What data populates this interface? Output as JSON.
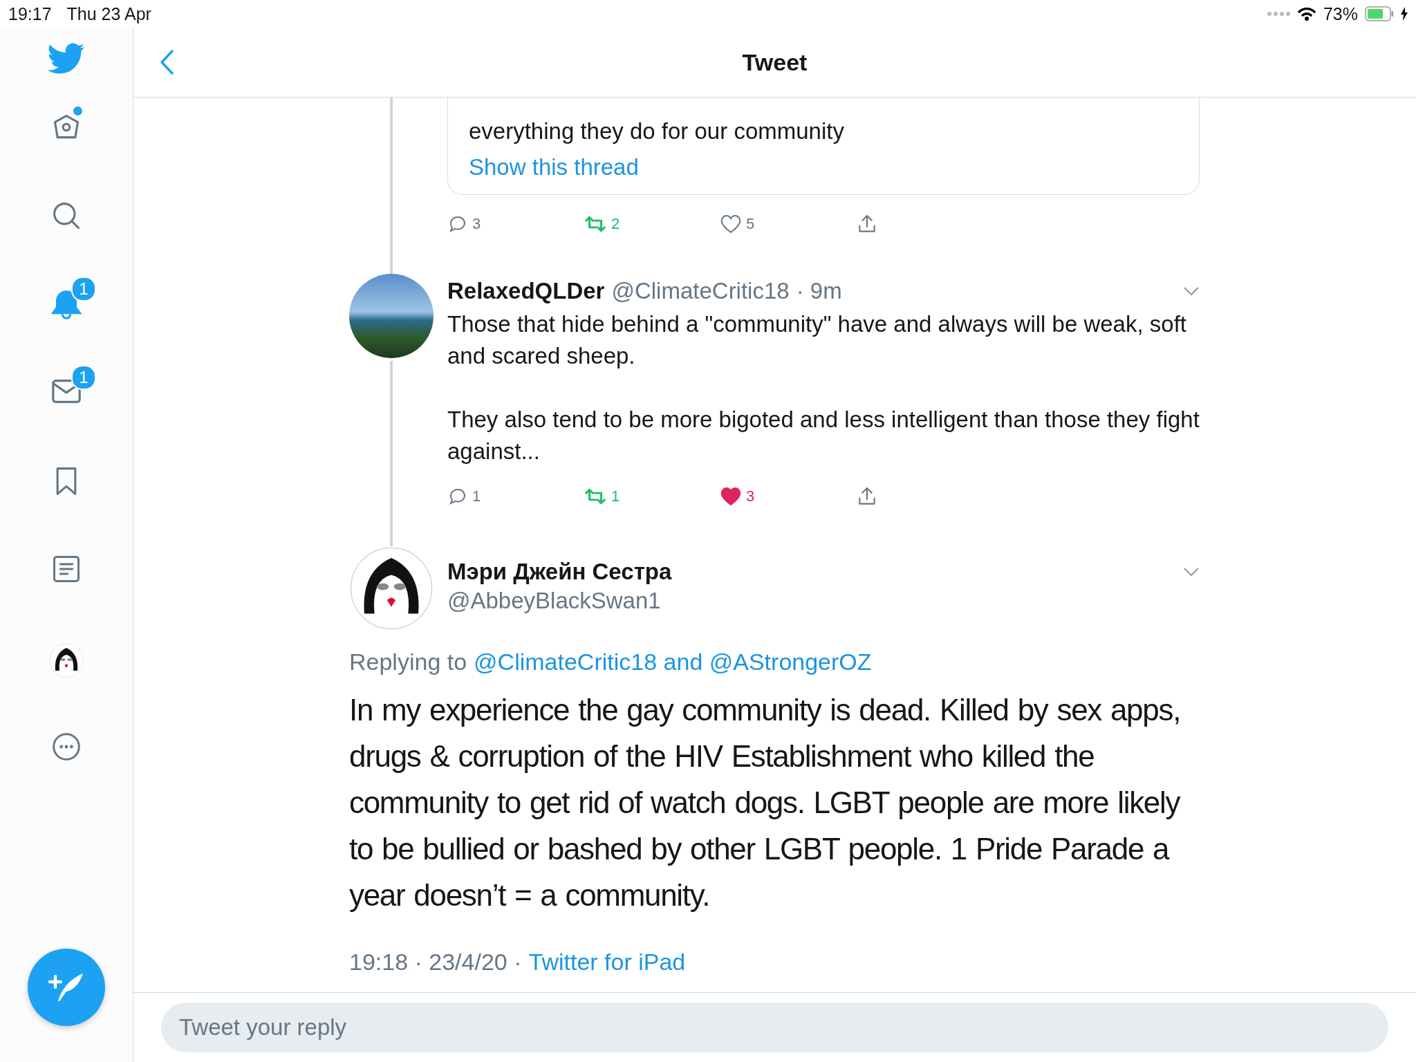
{
  "status_bar": {
    "time": "19:17",
    "date": "Thu 23 Apr",
    "battery": "73%",
    "charging": true
  },
  "sidebar": {
    "items": [
      {
        "kind": "home",
        "selected": false,
        "dot": true
      },
      {
        "kind": "search",
        "selected": false
      },
      {
        "kind": "notifications",
        "selected": true,
        "badge": "1"
      },
      {
        "kind": "messages",
        "selected": false,
        "badge": "1"
      },
      {
        "kind": "bookmarks",
        "selected": false
      },
      {
        "kind": "lists",
        "selected": false
      },
      {
        "kind": "profile",
        "selected": false
      },
      {
        "kind": "more",
        "selected": false
      }
    ]
  },
  "header": {
    "title": "Tweet"
  },
  "previous_tweet": {
    "text_tail": "everything they do for our community",
    "thread_link": "Show this thread",
    "actions": {
      "replies": "3",
      "retweets": "2",
      "retweeted": true,
      "likes": "5",
      "liked": false
    }
  },
  "reply_tweet": {
    "name": "RelaxedQLDer",
    "handle": "@ClimateCritic18",
    "time": "· 9m",
    "paragraphs": [
      "Those that hide behind a \"community\" have and always will be weak, soft and scared sheep.",
      "They also tend to be more bigoted and less intelligent than those they fight against..."
    ],
    "actions": {
      "replies": "1",
      "retweets": "1",
      "retweeted": true,
      "likes": "3",
      "liked": true
    }
  },
  "main_tweet": {
    "name": "Мэри Джейн Сестра",
    "handle": "@AbbeyBlackSwan1",
    "replying_label": "Replying to",
    "replying_to": "@ClimateCritic18 and @AStrongerOZ",
    "text": "In my experience the gay community is dead. Killed by sex apps, drugs & corruption of the HIV Establishment who killed the community to get rid of watch dogs. LGBT people are more likely to be bullied or bashed by other LGBT people. 1 Pride Parade a year doesn’t = a community.",
    "timestamp": "19:18 · 23/4/20 ·",
    "source": "Twitter for iPad"
  },
  "reply_field": {
    "placeholder": "Tweet your reply"
  }
}
